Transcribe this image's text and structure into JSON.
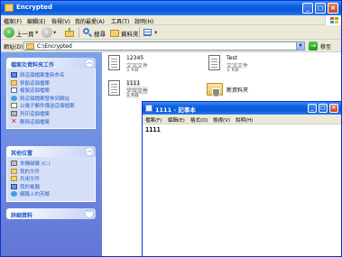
{
  "explorer": {
    "title": "Encrypted",
    "menu": [
      "檔案(F)",
      "編輯(E)",
      "檢視(V)",
      "我的最愛(A)",
      "工具(T)",
      "說明(H)"
    ],
    "toolbar": {
      "back": "上一頁",
      "search": "搜尋",
      "folders": "資料夾"
    },
    "address": {
      "label": "網址(D)",
      "value": "C:\\Encrypted",
      "go": "移至"
    }
  },
  "taskpane": {
    "file_tasks": {
      "title": "檔案及資料夾工作",
      "items": [
        "將這個檔案重新命名",
        "移動這個檔案",
        "複製這個檔案",
        "將這個檔案發佈到網站",
        "以電子郵件傳送這個檔案",
        "列印這個檔案",
        "刪除這個檔案"
      ]
    },
    "other_places": {
      "title": "其他位置",
      "items": [
        "本機磁碟 (C:)",
        "我的文件",
        "共用文件",
        "我的電腦",
        "網路上的芳鄰"
      ]
    },
    "details": {
      "title": "詳細資料"
    }
  },
  "files": [
    {
      "name": "12345",
      "type": "文字文件",
      "size": "1 KB"
    },
    {
      "name": "Test",
      "type": "文字文件",
      "size": "1 KB"
    },
    {
      "name": "1111",
      "type": "文字文件",
      "size": "1 KB"
    },
    {
      "name": "新資料夾"
    }
  ],
  "notepad": {
    "title": "1111 - 記事本",
    "menu": [
      "檔案(F)",
      "編輯(E)",
      "格式(O)",
      "檢視(V)",
      "說明(H)"
    ],
    "content": "1111"
  },
  "colors": {
    "titlebar": "#0a5ee0",
    "taskpane": "#6375d6",
    "link": "#215dc6"
  }
}
